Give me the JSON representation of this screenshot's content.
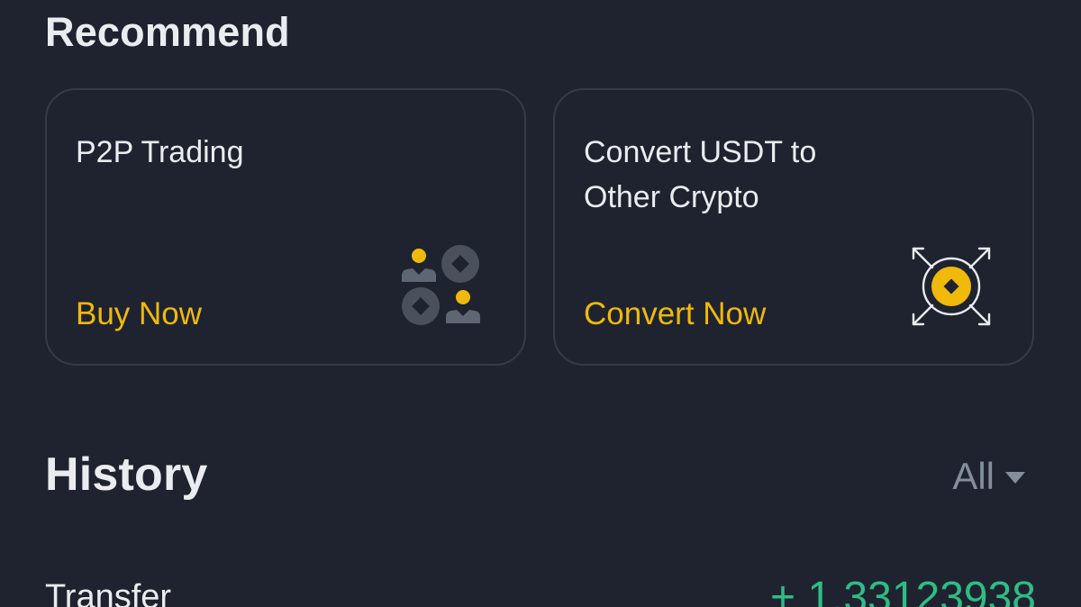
{
  "recommend": {
    "title": "Recommend",
    "cards": [
      {
        "title": "P2P Trading",
        "action": "Buy Now",
        "icon": "p2p-trading-icon"
      },
      {
        "title": "Convert USDT to Other Crypto",
        "action": "Convert Now",
        "icon": "convert-icon"
      }
    ]
  },
  "history": {
    "title": "History",
    "filter": {
      "selected": "All"
    },
    "rows": [
      {
        "type": "Transfer",
        "amount": "+ 1.33123938"
      }
    ]
  },
  "colors": {
    "background": "#1f2330",
    "card_border": "#363b48",
    "text_primary": "#eaecef",
    "text_secondary": "#848e9c",
    "accent": "#f0b90b",
    "positive": "#2ebd85"
  }
}
